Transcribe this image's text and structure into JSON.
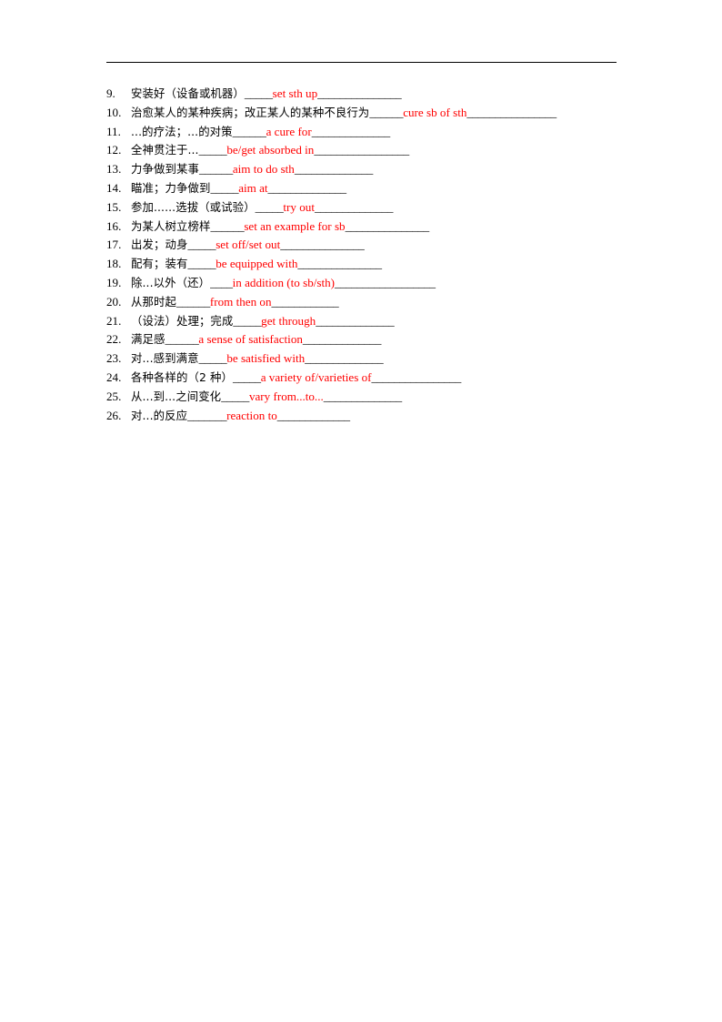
{
  "document": {
    "type": "worksheet",
    "title_text": "",
    "text_color": "#000000",
    "answer_color": "#FF0000",
    "header_rule": true
  },
  "items": [
    {
      "number": "9.",
      "chinese": "安装好（设备或机器）",
      "blank_before": "_____",
      "answer": "set sth up",
      "blank_after": "_______________"
    },
    {
      "number": "10.",
      "chinese": "治愈某人的某种疾病；改正某人的某种不良行为",
      "blank_before": "______",
      "answer": "cure sb of sth",
      "blank_after": "________________"
    },
    {
      "number": "11.",
      "chinese": "...的疗法；...的对策",
      "blank_before": "______",
      "answer": "a cure for",
      "blank_after": "______________"
    },
    {
      "number": "12.",
      "chinese": "全神贯注于...",
      "blank_before": "_____",
      "answer": "be/get absorbed in",
      "blank_after": "_________________"
    },
    {
      "number": "13.",
      "chinese": "力争做到某事",
      "blank_before": "______",
      "answer": "aim to do sth",
      "blank_after": "______________"
    },
    {
      "number": "14.",
      "chinese": "瞄准；力争做到",
      "blank_before": "_____",
      "answer": "aim at",
      "blank_after": "______________"
    },
    {
      "number": "15.",
      "chinese": "参加......选拔（或试验）",
      "blank_before": "_____",
      "answer": "try out",
      "blank_after": "______________"
    },
    {
      "number": "16.",
      "chinese": "为某人树立榜样",
      "blank_before": "______",
      "answer": "set an example for sb",
      "blank_after": "_______________"
    },
    {
      "number": "17.",
      "chinese": "出发；动身",
      "blank_before": "_____",
      "answer": "set off/set out",
      "blank_after": "_______________"
    },
    {
      "number": "18.",
      "chinese": "配有；装有",
      "blank_before": "_____",
      "answer": "be equipped with",
      "blank_after": "_______________"
    },
    {
      "number": "19.",
      "chinese": "除...以外（还）",
      "blank_before": "____",
      "answer": "in addition (to sb/sth)",
      "blank_after": "__________________"
    },
    {
      "number": "20.",
      "chinese": "从那时起",
      "blank_before": "______",
      "answer": "from then on",
      "blank_after": "____________"
    },
    {
      "number": "21.",
      "chinese": "（设法）处理；完成",
      "blank_before": "_____",
      "answer": "get through",
      "blank_after": "______________"
    },
    {
      "number": "22.",
      "chinese": "满足感",
      "blank_before": "______",
      "answer": "a sense of satisfaction",
      "blank_after": "______________"
    },
    {
      "number": "23.",
      "chinese": "对...感到满意",
      "blank_before": "_____",
      "answer": "be satisfied with",
      "blank_after": "______________"
    },
    {
      "number": "24.",
      "chinese": "各种各样的（2 种）",
      "blank_before": "_____",
      "answer": "a variety of/varieties of",
      "blank_after": "________________"
    },
    {
      "number": "25.",
      "chinese": "从...到...之间变化",
      "blank_before": "_____",
      "answer": "vary from...to...",
      "blank_after": "______________"
    },
    {
      "number": "26.",
      "chinese": "对...的反应",
      "blank_before": "_______",
      "answer": "reaction to",
      "blank_after": "_____________"
    }
  ]
}
